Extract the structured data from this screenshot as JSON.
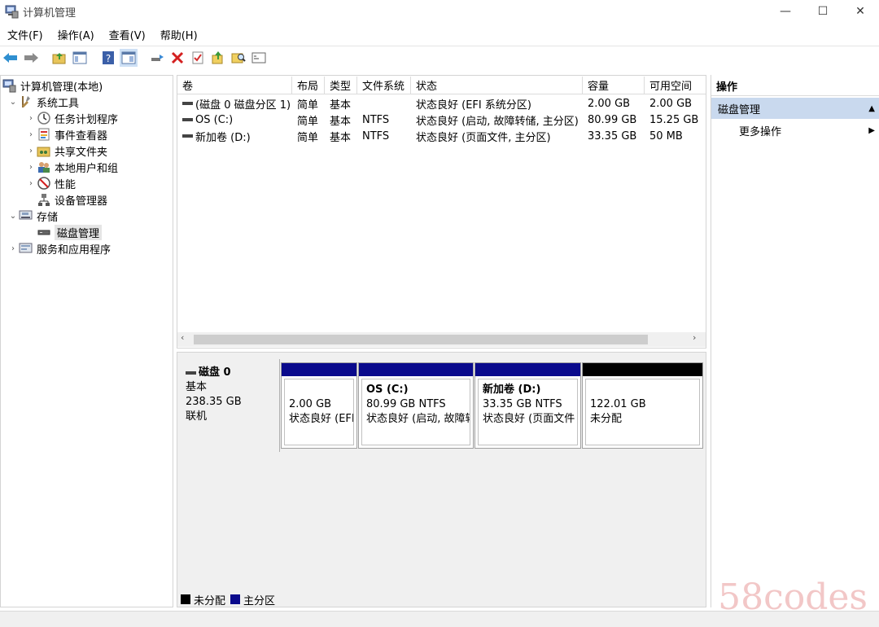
{
  "window": {
    "title": "计算机管理",
    "controls": {
      "minimize": "—",
      "maximize": "☐",
      "close": "✕"
    }
  },
  "menu": {
    "items": [
      "文件(F)",
      "操作(A)",
      "查看(V)",
      "帮助(H)"
    ]
  },
  "tree": {
    "root": "计算机管理(本地)",
    "system_tools": "系统工具",
    "task_scheduler": "任务计划程序",
    "event_viewer": "事件查看器",
    "shared_folders": "共享文件夹",
    "local_users": "本地用户和组",
    "performance": "性能",
    "device_manager": "设备管理器",
    "storage": "存储",
    "disk_management": "磁盘管理",
    "services_apps": "服务和应用程序"
  },
  "volume_table": {
    "columns": [
      "卷",
      "布局",
      "类型",
      "文件系统",
      "状态",
      "容量",
      "可用空间"
    ],
    "rows": [
      [
        "(磁盘 0 磁盘分区 1)",
        "简单",
        "基本",
        "",
        "状态良好 (EFI 系统分区)",
        "2.00 GB",
        "2.00 GB"
      ],
      [
        "OS (C:)",
        "简单",
        "基本",
        "NTFS",
        "状态良好 (启动, 故障转储, 主分区)",
        "80.99 GB",
        "15.25 GB"
      ],
      [
        "新加卷 (D:)",
        "简单",
        "基本",
        "NTFS",
        "状态良好 (页面文件, 主分区)",
        "33.35 GB",
        "50 MB"
      ]
    ],
    "scroll_left": "‹",
    "scroll_right": "›"
  },
  "disk": {
    "name": "磁盘 0",
    "type": "基本",
    "size": "238.35 GB",
    "status": "联机",
    "partitions": [
      {
        "title": "",
        "size": "2.00 GB",
        "status": "状态良好 (EFI"
      },
      {
        "title": "OS  (C:)",
        "size": "80.99 GB NTFS",
        "status": "状态良好 (启动, 故障转"
      },
      {
        "title": "新加卷  (D:)",
        "size": "33.35 GB NTFS",
        "status": "状态良好 (页面文件"
      },
      {
        "title": "",
        "size": "122.01 GB",
        "status": "未分配"
      }
    ]
  },
  "legend": {
    "unallocated": "未分配",
    "primary": "主分区"
  },
  "actions": {
    "header": "操作",
    "section": "磁盘管理",
    "more": "更多操作",
    "collapse_glyph": "▲",
    "more_glyph": "▶"
  },
  "colors": {
    "primary_partition": "#0a0a8c",
    "unallocated": "#000000",
    "selection": "#c9d9ee"
  },
  "watermark": "58codes"
}
